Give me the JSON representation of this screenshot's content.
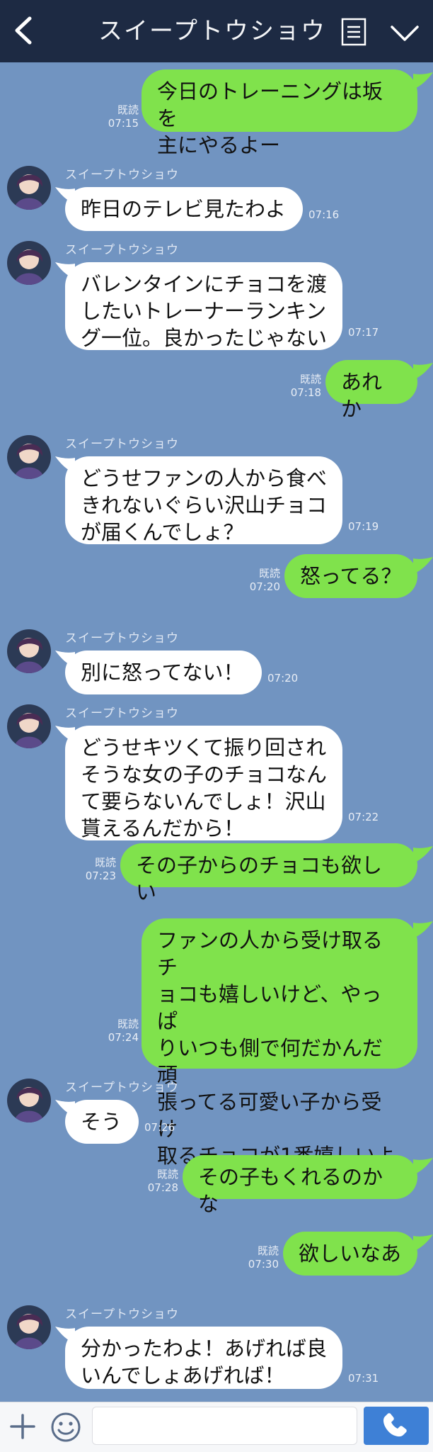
{
  "header": {
    "title": "スイープトウショウ"
  },
  "sender_name": "スイープトウショウ",
  "read_label": "既読",
  "colors": {
    "background": "#7194c1",
    "header": "#1d2a43",
    "my_bubble": "#80e24c",
    "their_bubble": "#ffffff",
    "send_button": "#3e80d6"
  },
  "messages": [
    {
      "side": "right",
      "text": "今日のトレーニングは坂を\n主にやるよー",
      "read": "既読",
      "time": "07:15"
    },
    {
      "side": "left",
      "sender": "スイープトウショウ",
      "text": "昨日のテレビ見たわよ",
      "time": "07:16"
    },
    {
      "side": "left",
      "sender": "スイープトウショウ",
      "text": "バレンタインにチョコを渡\nしたいトレーナーランキン\nグ一位。良かったじゃない",
      "time": "07:17"
    },
    {
      "side": "right",
      "text": "あれか",
      "read": "既読",
      "time": "07:18"
    },
    {
      "side": "left",
      "sender": "スイープトウショウ",
      "text": "どうせファンの人から食べ\nきれないぐらい沢山チョコ\nが届くんでしょ？",
      "time": "07:19"
    },
    {
      "side": "right",
      "text": "怒ってる？",
      "read": "既読",
      "time": "07:20"
    },
    {
      "side": "left",
      "sender": "スイープトウショウ",
      "text": "別に怒ってない！",
      "time": "07:20"
    },
    {
      "side": "left",
      "sender": "スイープトウショウ",
      "text": "どうせキツくて振り回され\nそうな女の子のチョコなん\nて要らないんでしょ！沢山\n貰えるんだから！",
      "time": "07:22"
    },
    {
      "side": "right",
      "text": "その子からのチョコも欲しい",
      "read": "既読",
      "time": "07:23"
    },
    {
      "side": "right",
      "text": "ファンの人から受け取るチ\nョコも嬉しいけど、やっぱ\nりいつも側で何だかんだ頑\n張ってる可愛い子から受け\n取るチョコが1番嬉しいよ",
      "read": "既読",
      "time": "07:24"
    },
    {
      "side": "left",
      "sender": "スイープトウショウ",
      "text": "そう",
      "time": "07:26"
    },
    {
      "side": "right",
      "text": "その子もくれるのかな",
      "read": "既読",
      "time": "07:28"
    },
    {
      "side": "right",
      "text": "欲しいなあ",
      "read": "既読",
      "time": "07:30"
    },
    {
      "side": "left",
      "sender": "スイープトウショウ",
      "text": "分かったわよ！あげれば良\nいんでしょあげれば！",
      "time": "07:31"
    }
  ],
  "footer": {
    "input_placeholder": ""
  }
}
